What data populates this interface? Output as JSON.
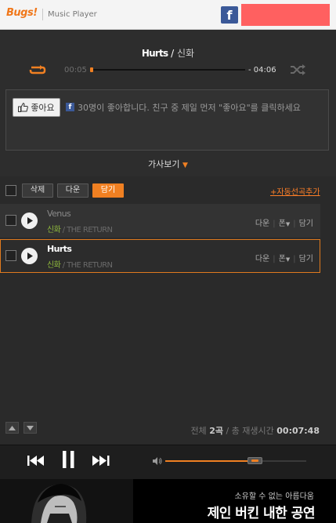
{
  "header": {
    "logo_text": "Bugs!",
    "app_name": "Music Player",
    "fb_glyph": "f",
    "accent_color": "#f08022",
    "highlight_box_color": "#ff6060"
  },
  "now_playing": {
    "title": "Hurts",
    "artist_prefix": " / ",
    "artist": "신화",
    "time_current": "00:05",
    "time_total": "- 04:06",
    "progress_fraction": 0.02
  },
  "social": {
    "like_label": "좋아요",
    "fb_glyph": "f",
    "like_text": "30명이 좋아합니다. 친구 중 제일 먼저 \"좋아요\"를 클릭하세요"
  },
  "lyrics": {
    "label": "가사보기",
    "caret": "▼"
  },
  "toolbar": {
    "delete_label": "삭제",
    "download_label": "다운",
    "get_label": "담기",
    "auto_add_label": "+자동선곡추가"
  },
  "tracks": [
    {
      "title": "Venus",
      "artist": "신화",
      "album": " / THE RETURN",
      "action_download": "다운",
      "action_phone": "폰",
      "action_get": "담기",
      "playing": false
    },
    {
      "title": "Hurts",
      "artist": "신화",
      "album": " / THE RETURN",
      "action_download": "다운",
      "action_phone": "폰",
      "action_get": "담기",
      "playing": true
    }
  ],
  "status": {
    "total_prefix": "전체 ",
    "total_count": "2곡",
    "total_mid": " / 총 재생시간 ",
    "total_time": "00:07:48"
  },
  "volume": {
    "level_fraction": 0.63
  },
  "banner": {
    "line1": "소유할 수 없는 아름다움",
    "line2": "제인 버킨 내한 공연"
  }
}
